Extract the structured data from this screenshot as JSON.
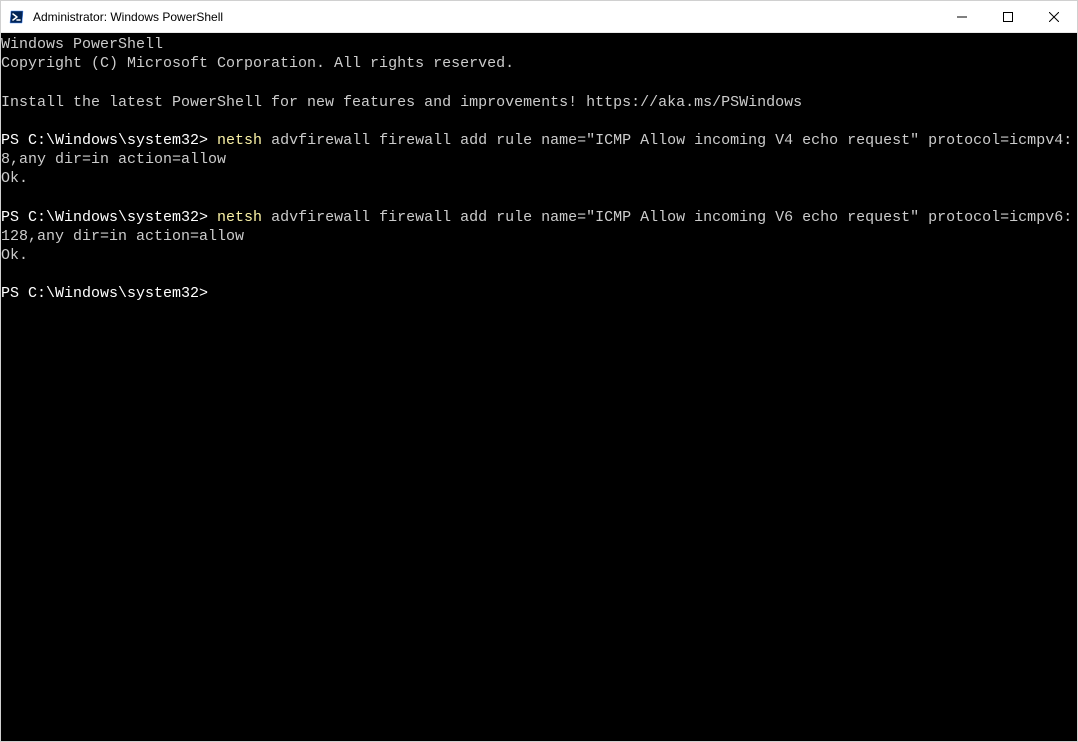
{
  "titlebar": {
    "title": "Administrator: Windows PowerShell"
  },
  "terminal": {
    "header_line1": "Windows PowerShell",
    "header_line2": "Copyright (C) Microsoft Corporation. All rights reserved.",
    "install_msg": "Install the latest PowerShell for new features and improvements! https://aka.ms/PSWindows",
    "prompt": "PS C:\\Windows\\system32> ",
    "cmd1_part1": "netsh",
    "cmd1_part2": " advfirewall firewall add rule name=\"ICMP Allow incoming V4 echo request\" protocol=icmpv4:8,any dir=in action=allow",
    "result1": "Ok.",
    "cmd2_part1": "netsh",
    "cmd2_part2": " advfirewall firewall add rule name=\"ICMP Allow incoming V6 echo request\" protocol=icmpv6:128,any dir=in action=allow",
    "result2": "Ok.",
    "final_prompt": "PS C:\\Windows\\system32>"
  },
  "icons": {
    "app": "powershell-icon",
    "minimize": "minimize-icon",
    "maximize": "maximize-icon",
    "close": "close-icon"
  }
}
